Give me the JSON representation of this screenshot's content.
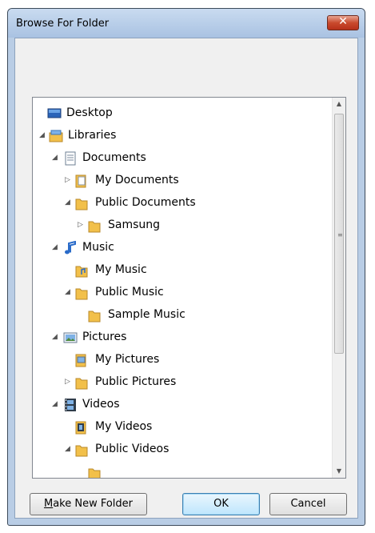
{
  "window": {
    "title": "Browse For Folder",
    "close_glyph": "✕"
  },
  "tree": {
    "items": [
      {
        "label": "Desktop",
        "icon": "desktop-icon",
        "arrow": ""
      },
      {
        "label": "Libraries",
        "icon": "libraries-icon",
        "arrow": "expanded"
      },
      {
        "label": "Documents",
        "icon": "documents-library-icon",
        "arrow": "expanded"
      },
      {
        "label": "My Documents",
        "icon": "documents-folder-icon",
        "arrow": "collapsed"
      },
      {
        "label": "Public Documents",
        "icon": "folder-icon",
        "arrow": "expanded"
      },
      {
        "label": "Samsung",
        "icon": "folder-icon",
        "arrow": "collapsed"
      },
      {
        "label": "Music",
        "icon": "music-library-icon",
        "arrow": "expanded"
      },
      {
        "label": "My Music",
        "icon": "music-folder-icon",
        "arrow": ""
      },
      {
        "label": "Public Music",
        "icon": "folder-icon",
        "arrow": "expanded"
      },
      {
        "label": "Sample Music",
        "icon": "folder-icon",
        "arrow": ""
      },
      {
        "label": "Pictures",
        "icon": "pictures-library-icon",
        "arrow": "expanded"
      },
      {
        "label": "My Pictures",
        "icon": "pictures-folder-icon",
        "arrow": ""
      },
      {
        "label": "Public Pictures",
        "icon": "folder-icon",
        "arrow": "collapsed"
      },
      {
        "label": "Videos",
        "icon": "videos-library-icon",
        "arrow": "expanded"
      },
      {
        "label": "My Videos",
        "icon": "videos-folder-icon",
        "arrow": ""
      },
      {
        "label": "Public Videos",
        "icon": "folder-icon",
        "arrow": "expanded"
      }
    ]
  },
  "buttons": {
    "make_new_folder_prefix": "M",
    "make_new_folder_rest": "ake New Folder",
    "ok": "OK",
    "cancel": "Cancel"
  },
  "colors": {
    "accent": "#3c7fb1",
    "close": "#c94a2d",
    "folder": "#f2c04a"
  }
}
